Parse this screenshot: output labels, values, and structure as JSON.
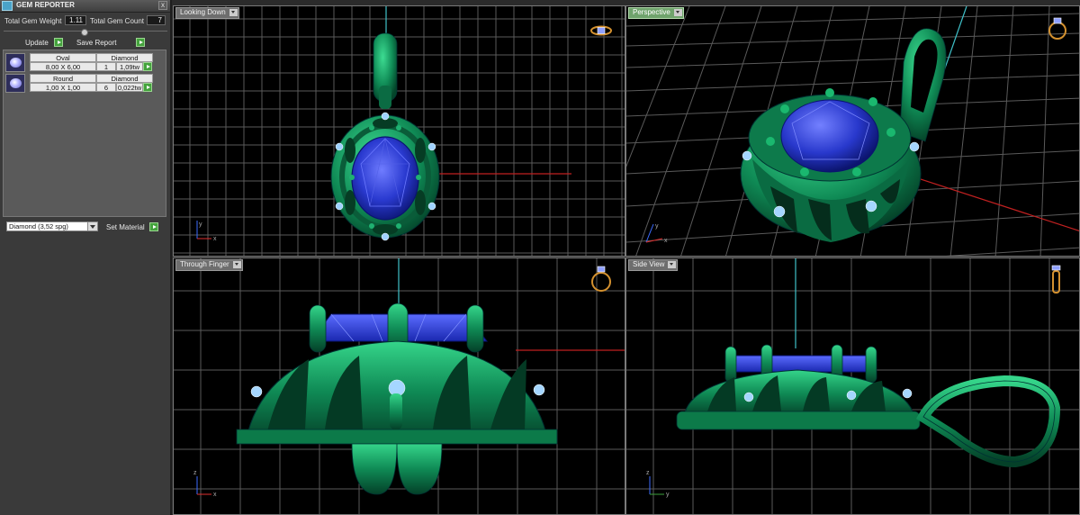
{
  "panel": {
    "title": "GEM REPORTER",
    "close": "x",
    "total_weight_label": "Total Gem Weight",
    "total_weight_value": "1.11",
    "total_count_label": "Total Gem Count",
    "total_count_value": "7",
    "update_label": "Update",
    "save_report_label": "Save Report",
    "gems": [
      {
        "shape": "Oval",
        "material": "Diamond",
        "size": "8,00 X 6,00",
        "count": "1",
        "weight": "1,09tw"
      },
      {
        "shape": "Round",
        "material": "Diamond",
        "size": "1,00 X 1,00",
        "count": "6",
        "weight": "0,022tw"
      }
    ],
    "material_select": "Diamond     (3,52 spg)",
    "set_material_label": "Set Material"
  },
  "viewports": [
    {
      "label": "Looking Down",
      "active": false,
      "axes": [
        "x",
        "y"
      ],
      "icon": "ring-top-icon"
    },
    {
      "label": "Perspective",
      "active": true,
      "axes": [
        "x",
        "y"
      ],
      "icon": "ring-perspective-icon"
    },
    {
      "label": "Through Finger",
      "active": false,
      "axes": [
        "x",
        "z"
      ],
      "icon": "ring-front-icon"
    },
    {
      "label": "Side View",
      "active": false,
      "axes": [
        "y",
        "z"
      ],
      "icon": "ring-side-icon"
    }
  ],
  "colors": {
    "metal": "#0f8a55",
    "gem": "#2a3ad0",
    "grid": "#5a5a5a",
    "active_label": "#6fa36c"
  }
}
